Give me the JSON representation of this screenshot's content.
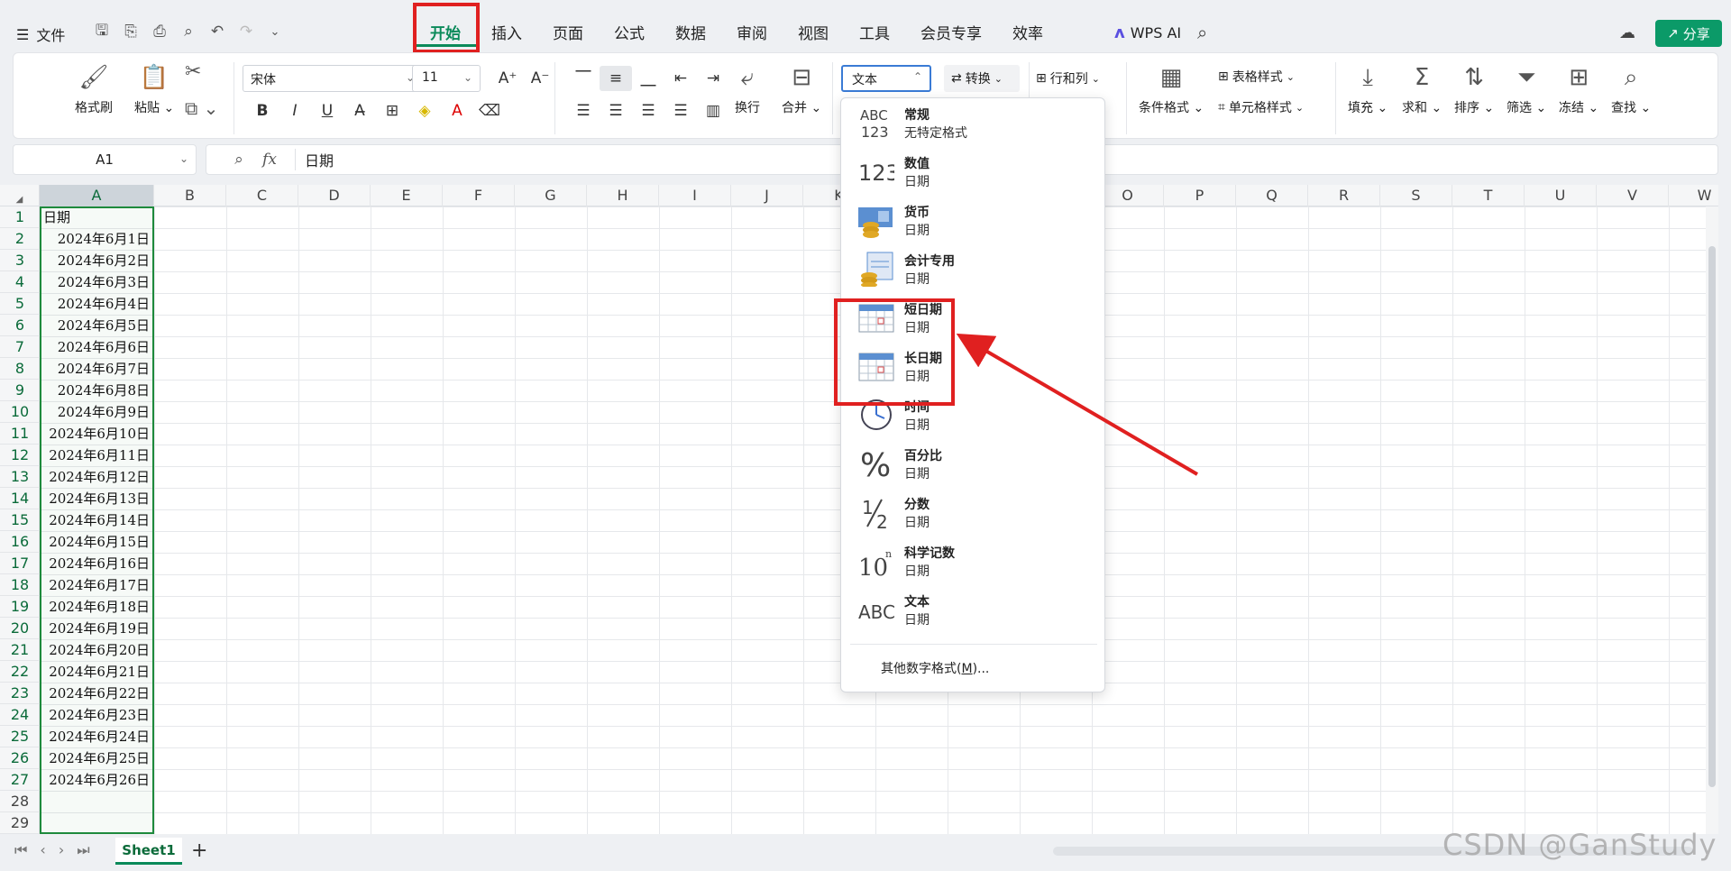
{
  "menubar": {
    "file_label": "文件",
    "tabs": [
      "开始",
      "插入",
      "页面",
      "公式",
      "数据",
      "审阅",
      "视图",
      "工具",
      "会员专享",
      "效率"
    ],
    "wps_ai": "WPS AI",
    "share": "分享"
  },
  "ribbon": {
    "format_painter": "格式刷",
    "paste": "粘贴",
    "font_name": "宋体",
    "font_size": "11",
    "wrap": "换行",
    "merge": "合并",
    "number_format": "文本",
    "convert": "转换",
    "row_col": "行和列",
    "cond_format": "条件格式",
    "table_style": "表格样式",
    "cell_style": "单元格样式",
    "fill": "填充",
    "sum": "求和",
    "sort": "排序",
    "filter": "筛选",
    "freeze": "冻结",
    "find": "查找"
  },
  "formula_bar": {
    "cell_ref": "A1",
    "fx": "fx",
    "value": "日期"
  },
  "grid": {
    "columns": [
      "A",
      "B",
      "C",
      "D",
      "E",
      "F",
      "G",
      "H",
      "I",
      "J",
      "K",
      "L",
      "M",
      "N",
      "O",
      "P",
      "Q",
      "R",
      "S",
      "T",
      "U",
      "V",
      "W"
    ],
    "rows": [
      "1",
      "2",
      "3",
      "4",
      "5",
      "6",
      "7",
      "8",
      "9",
      "10",
      "11",
      "12",
      "13",
      "14",
      "15",
      "16",
      "17",
      "18",
      "19",
      "20",
      "21",
      "22",
      "23",
      "24",
      "25",
      "26",
      "27",
      "28",
      "29"
    ],
    "columnA": [
      "日期",
      "2024年6月1日",
      "2024年6月2日",
      "2024年6月3日",
      "2024年6月4日",
      "2024年6月5日",
      "2024年6月6日",
      "2024年6月7日",
      "2024年6月8日",
      "2024年6月9日",
      "2024年6月10日",
      "2024年6月11日",
      "2024年6月12日",
      "2024年6月13日",
      "2024年6月14日",
      "2024年6月15日",
      "2024年6月16日",
      "2024年6月17日",
      "2024年6月18日",
      "2024年6月19日",
      "2024年6月20日",
      "2024年6月21日",
      "2024年6月22日",
      "2024年6月23日",
      "2024年6月24日",
      "2024年6月25日",
      "2024年6月26日",
      "",
      ""
    ]
  },
  "dropdown": {
    "items": [
      {
        "name": "常规",
        "sample": "无特定格式",
        "icon": "abc123-icon"
      },
      {
        "name": "数值",
        "sample": "日期",
        "icon": "number-icon"
      },
      {
        "name": "货币",
        "sample": "日期",
        "icon": "currency-icon"
      },
      {
        "name": "会计专用",
        "sample": "日期",
        "icon": "accounting-icon"
      },
      {
        "name": "短日期",
        "sample": "日期",
        "icon": "calendar-icon"
      },
      {
        "name": "长日期",
        "sample": "日期",
        "icon": "calendar-icon"
      },
      {
        "name": "时间",
        "sample": "日期",
        "icon": "clock-icon"
      },
      {
        "name": "百分比",
        "sample": "日期",
        "icon": "percent-icon"
      },
      {
        "name": "分数",
        "sample": "日期",
        "icon": "fraction-icon"
      },
      {
        "name": "科学记数",
        "sample": "日期",
        "icon": "scientific-icon"
      },
      {
        "name": "文本",
        "sample": "日期",
        "icon": "text-abc-icon"
      }
    ],
    "more_prefix": "其他数字格式(",
    "more_key": "M",
    "more_suffix": ")..."
  },
  "sheets": {
    "active": "Sheet1"
  },
  "watermark": "CSDN @GanStudy",
  "colors": {
    "accent": "#0b8a5a",
    "highlight": "#e02020",
    "selection": "#1e8a3c"
  }
}
